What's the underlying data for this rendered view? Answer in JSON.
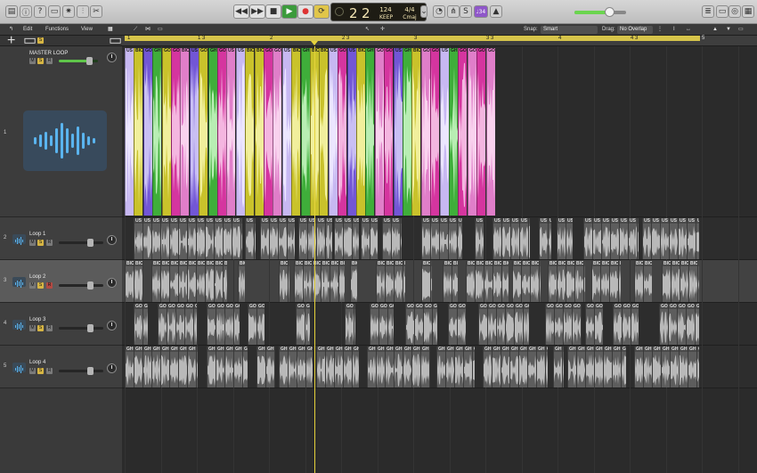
{
  "control_bar": {
    "lcd": {
      "bar": "2",
      "beat": "2",
      "tempo": "124",
      "tempo_label": "KEEP",
      "time_sig": "4/4",
      "key": "Cmaj"
    },
    "badge": "♩34"
  },
  "toolbar": {
    "edit": "Edit",
    "functions": "Functions",
    "view": "View",
    "snap_label": "Snap:",
    "snap_value": "Smart",
    "drag_label": "Drag:",
    "drag_value": "No Overlap"
  },
  "ruler": {
    "bars": [
      {
        "label": "1",
        "dark": true
      },
      {
        "label": "1 3",
        "dark": true
      },
      {
        "label": "2",
        "dark": true
      },
      {
        "label": "2 3",
        "dark": true
      },
      {
        "label": "3",
        "dark": true
      },
      {
        "label": "3 3",
        "dark": true
      },
      {
        "label": "4",
        "dark": true
      },
      {
        "label": "4 3",
        "dark": true
      },
      {
        "label": "5",
        "dark": false
      }
    ]
  },
  "tracks": [
    {
      "number": "1",
      "name": "MASTER LOOP",
      "mute": "M",
      "solo": "S",
      "record": "R"
    },
    {
      "number": "2",
      "name": "Loop 1",
      "mute": "M",
      "solo": "S",
      "record": "R"
    },
    {
      "number": "3",
      "name": "Loop 2",
      "mute": "M",
      "solo": "S",
      "record": "R"
    },
    {
      "number": "4",
      "name": "Loop 3",
      "mute": "M",
      "solo": "S",
      "record": "R"
    },
    {
      "number": "5",
      "name": "Loop 4",
      "mute": "M",
      "solo": "S",
      "record": "R"
    }
  ],
  "region_labels": {
    "us": "US",
    "gh": "GH",
    "go": "GO",
    "bc": "BIC"
  },
  "colors": {
    "purple": "#7256d6",
    "lavender": "#c7b8f2",
    "green": "#3fae3a",
    "yellow": "#c9c22b",
    "magenta": "#d5359f",
    "pink": "#e07ec9",
    "playhead": "#e6d23b"
  }
}
